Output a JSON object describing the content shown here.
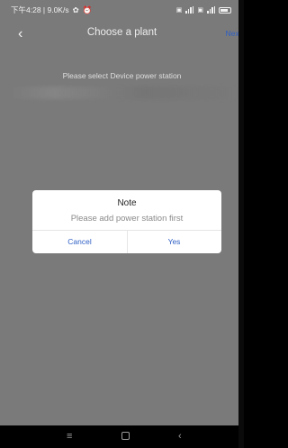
{
  "status_bar": {
    "left_text": "下午4:28 | 9.0K/s",
    "icons": [
      "wechat-icon",
      "alarm-icon"
    ],
    "right_icons": [
      "hd-icon",
      "signal-icon",
      "hd-icon",
      "signal-icon",
      "battery-icon"
    ]
  },
  "header": {
    "back_icon": "chevron-left-icon",
    "back_glyph": "‹",
    "title": "Choose a plant",
    "next_label": "Next"
  },
  "main": {
    "subtitle": "Please select Device power station"
  },
  "dialog": {
    "title": "Note",
    "message": "Please add power station first",
    "cancel_label": "Cancel",
    "yes_label": "Yes"
  },
  "system_nav": {
    "menu_glyph": "≡",
    "back_glyph": "‹"
  },
  "colors": {
    "overlay_bg": "#7a7a7a",
    "accent": "#2e5fc4",
    "dialog_bg": "#ffffff"
  }
}
